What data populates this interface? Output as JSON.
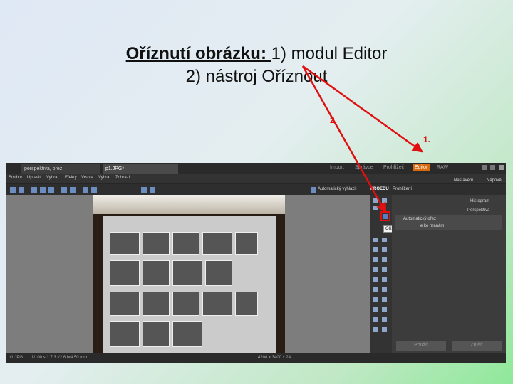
{
  "slide": {
    "title_bold": "Oříznutí obrázku: ",
    "title_rest": "1) modul Editor",
    "title_line2": "2) nástroj Oříznout",
    "marker_2": "2.",
    "marker_1": "1."
  },
  "app": {
    "tabs": [
      {
        "label": "perspektiva, orez"
      },
      {
        "label": "p1.JPG*"
      }
    ],
    "modules": [
      {
        "label": "Import"
      },
      {
        "label": "Správce"
      },
      {
        "label": "Prohlížeč"
      },
      {
        "label": "Editor"
      },
      {
        "label": "RAW"
      }
    ],
    "menu": [
      "Soubor",
      "Upravit",
      "Vybrat",
      "Efekty",
      "Vrstva",
      "Vybrat",
      "Zobrazit"
    ],
    "toolbar": {
      "auto_label": "Automatický vyhlazit",
      "pro_label": "PROEDU",
      "preview_label": "Prohlížení",
      "settings_label": "Nastavení",
      "help_label": "Nápově"
    },
    "tooltip": "Oříznout (C)",
    "right_panel": {
      "histogram": "Histogram",
      "perspective": "Perspektiva",
      "option1": "Automatický ořez",
      "option2": "e ke hranám",
      "apply": "Použít",
      "cancel": "Zrušit"
    },
    "status": {
      "zoom": "p1.JPG",
      "exif": "1/100 s  1.7.3  f/2.8  f=4.50 mm",
      "size": "4208 x 3400 x 24"
    },
    "accent_color": "#d96b0f",
    "annotation_color": "#e01010"
  }
}
